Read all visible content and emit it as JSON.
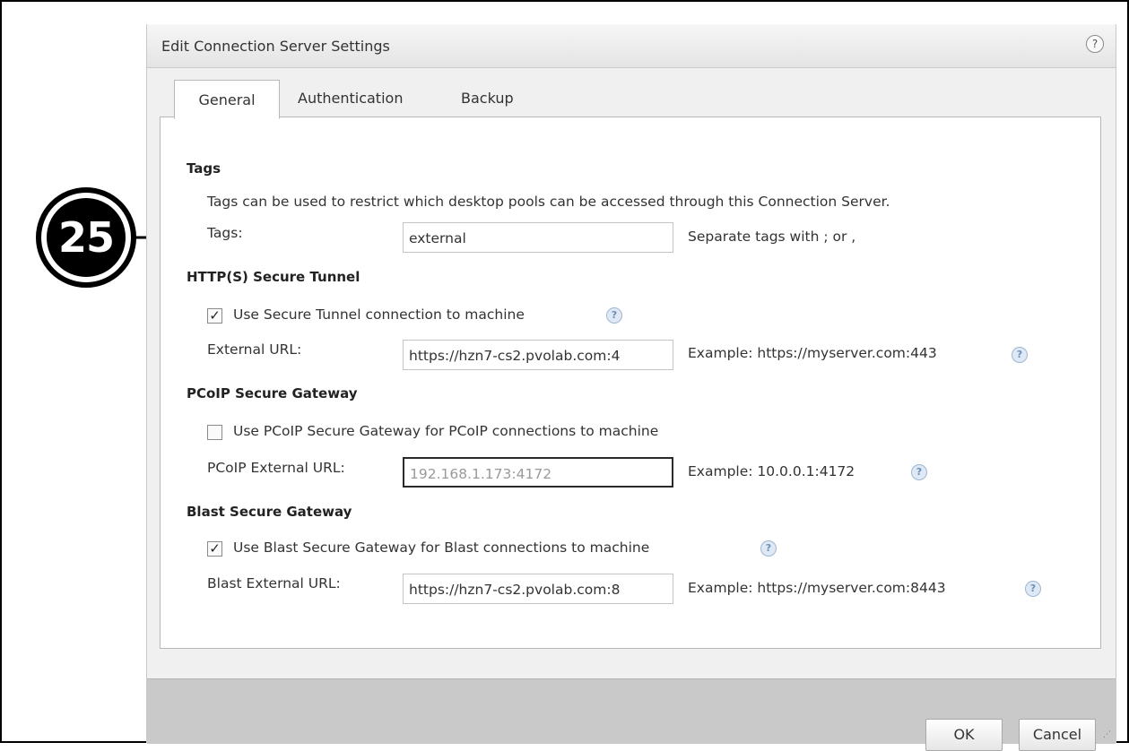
{
  "dialog": {
    "title": "Edit Connection Server Settings",
    "help_symbol": "?"
  },
  "tabs": [
    {
      "label": "General",
      "active": true
    },
    {
      "label": "Authentication",
      "active": false
    },
    {
      "label": "Backup",
      "active": false
    }
  ],
  "tags": {
    "heading": "Tags",
    "description": "Tags can be used to restrict which desktop pools can be accessed through this Connection Server.",
    "label": "Tags:",
    "value": "external",
    "hint": "Separate tags with ; or ,"
  },
  "secure_tunnel": {
    "heading": "HTTP(S) Secure Tunnel",
    "checkbox_label": "Use Secure Tunnel connection to machine",
    "checked": true,
    "url_label": "External URL:",
    "url_value": "https://hzn7-cs2.pvolab.com:4",
    "example": "Example: https://myserver.com:443"
  },
  "pcoip": {
    "heading": "PCoIP Secure Gateway",
    "checkbox_label": "Use PCoIP Secure Gateway for PCoIP connections to machine",
    "checked": false,
    "url_label": "PCoIP External URL:",
    "url_value": "192.168.1.173:4172",
    "example": "Example: 10.0.0.1:4172"
  },
  "blast": {
    "heading": "Blast Secure Gateway",
    "checkbox_label": "Use Blast Secure Gateway for Blast connections to machine",
    "checked": true,
    "url_label": "Blast External URL:",
    "url_value": "https://hzn7-cs2.pvolab.com:8",
    "example": "Example: https://myserver.com:8443"
  },
  "footer": {
    "ok_label": "OK",
    "cancel_label": "Cancel"
  },
  "callout": {
    "number": "25"
  },
  "icons": {
    "check": "✓",
    "question": "?"
  }
}
